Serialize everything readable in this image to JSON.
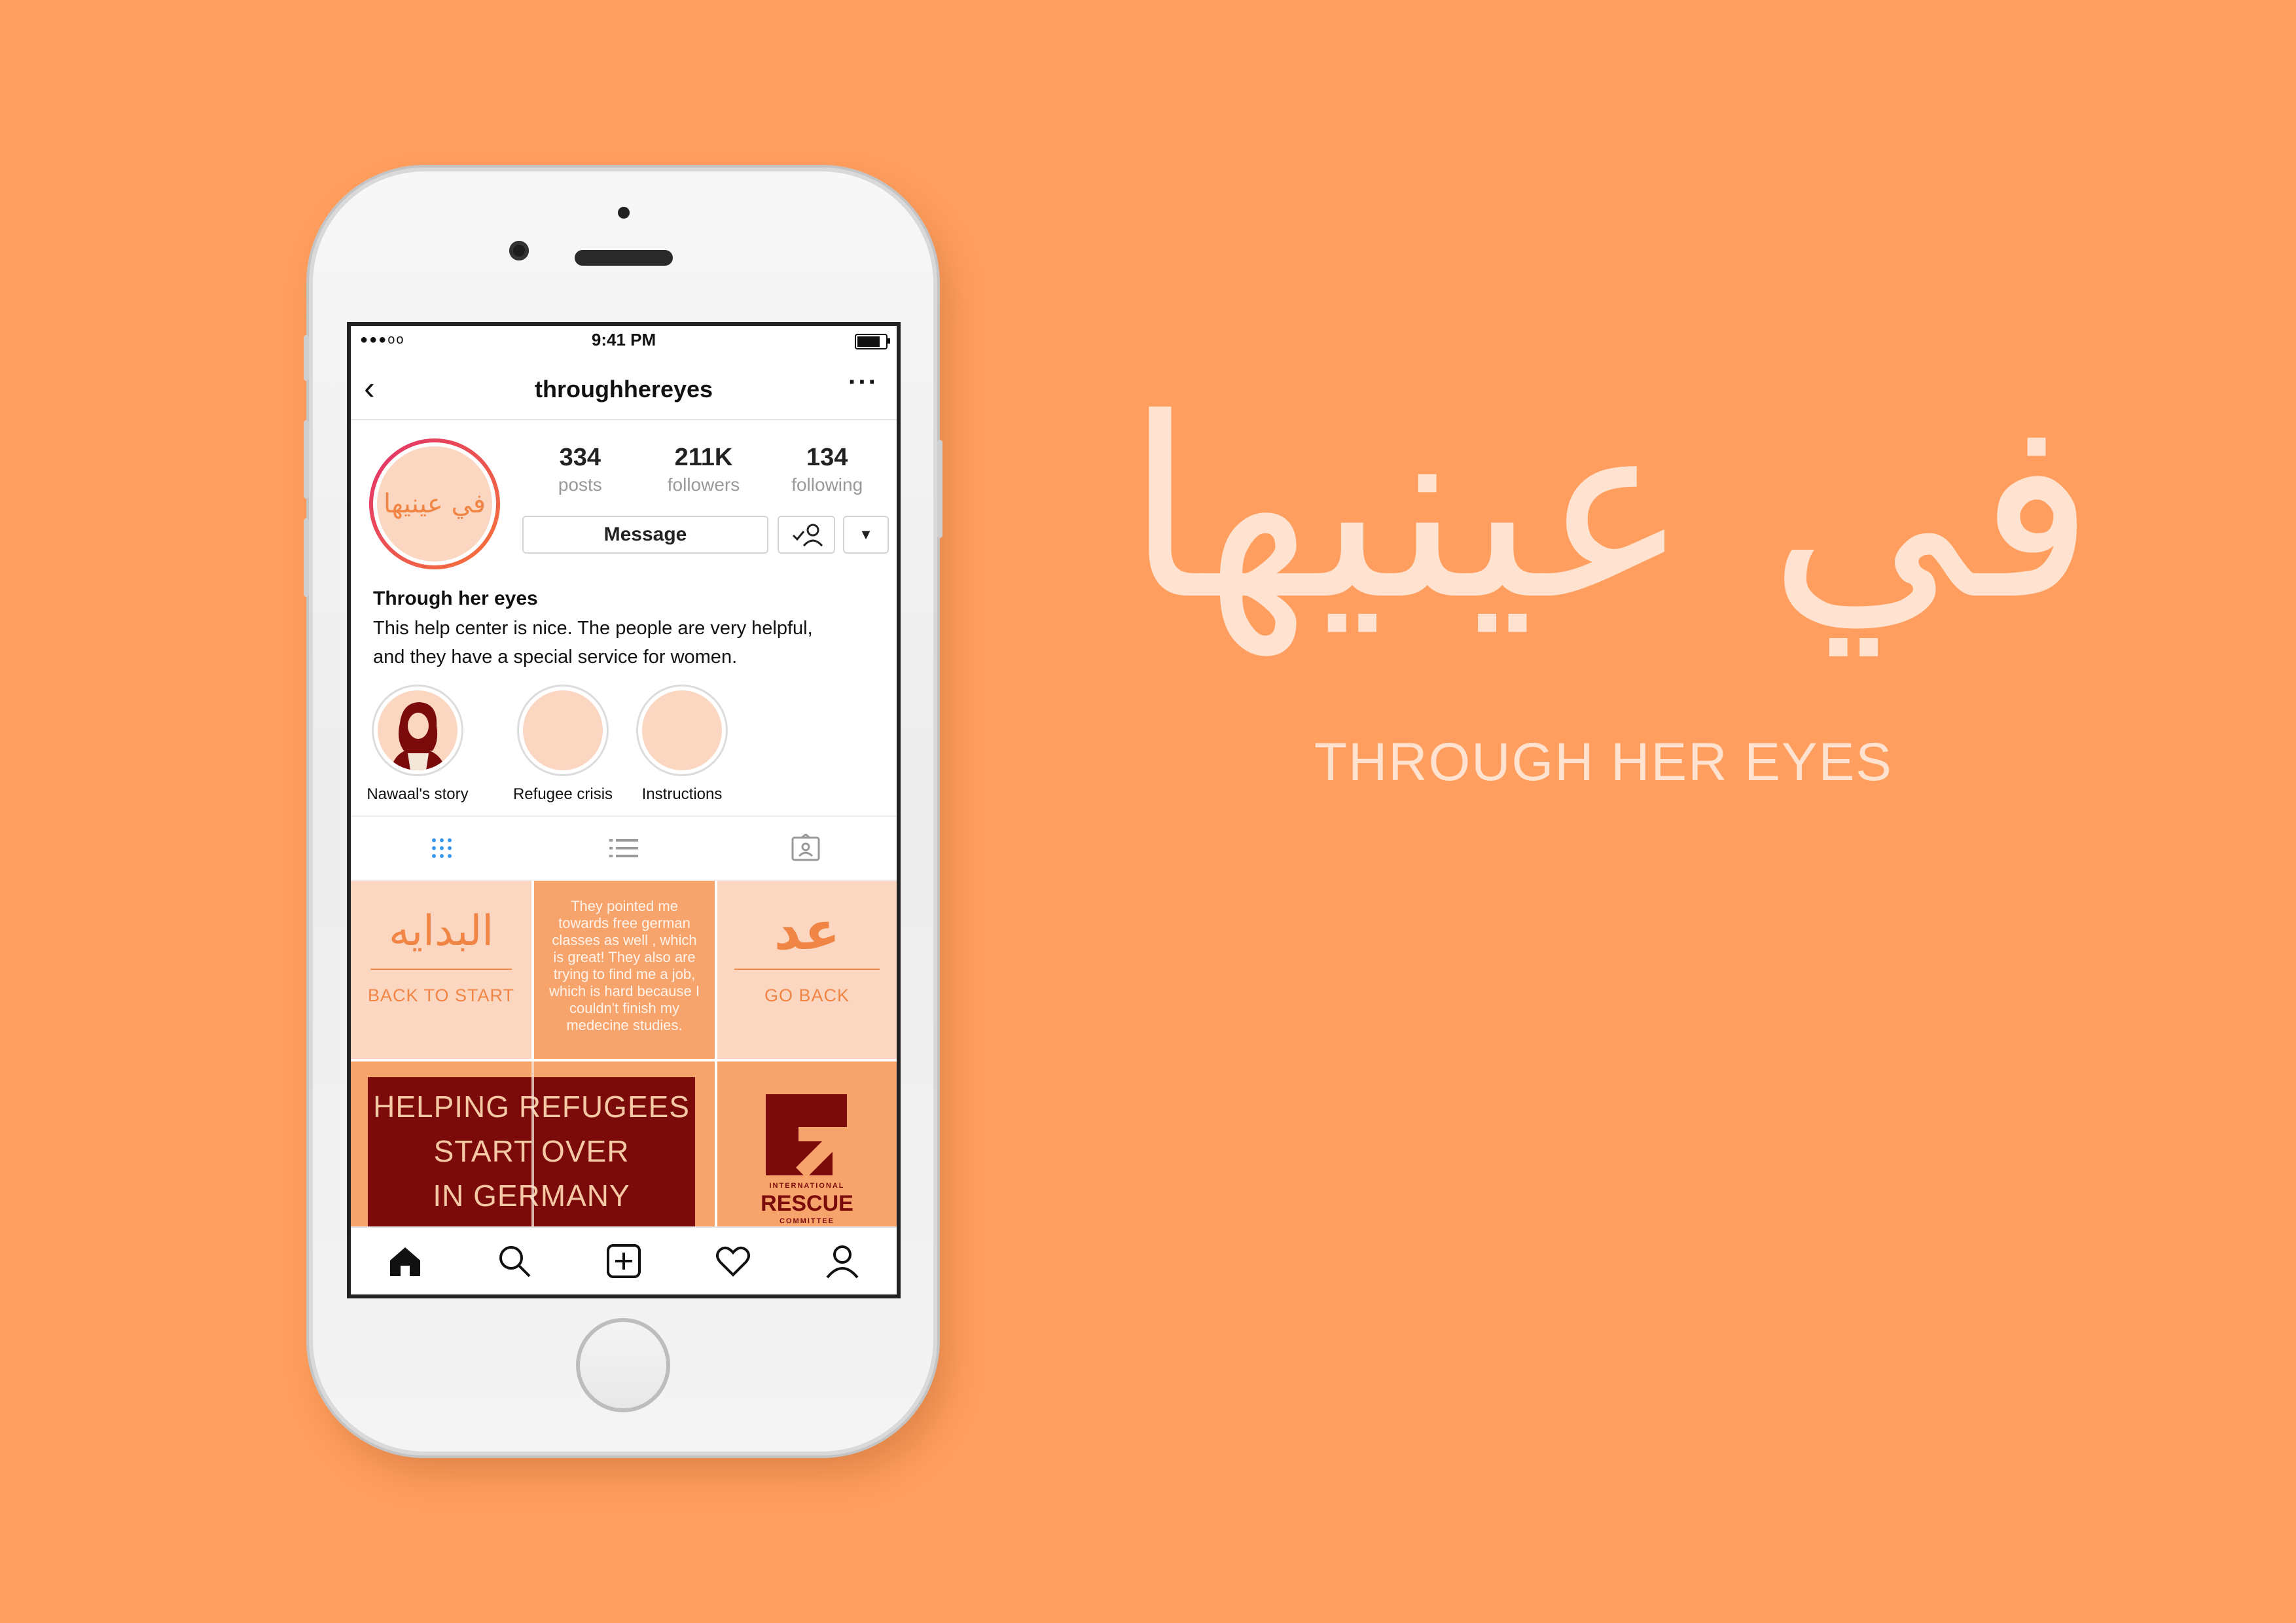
{
  "status_bar": {
    "time": "9:41 PM",
    "signal": "●●●oo"
  },
  "nav": {
    "username": "throughhereyes",
    "back_glyph": "‹",
    "more_glyph": "···"
  },
  "profile": {
    "avatar_text": "في عينيها",
    "stats": [
      {
        "value": "334",
        "label": "posts"
      },
      {
        "value": "211K",
        "label": "followers"
      },
      {
        "value": "134",
        "label": "following"
      }
    ],
    "message_label": "Message",
    "dropdown_glyph": "▼",
    "name": "Through her eyes",
    "bio_line1": "This help center is nice. The people are very helpful,",
    "bio_line2": "and they have a special service for women."
  },
  "highlights": [
    {
      "label": "Nawaal's story"
    },
    {
      "label": "Refugee crisis"
    },
    {
      "label": "Instructions"
    }
  ],
  "grid": {
    "post1": {
      "arabic": "البدايه",
      "caption": "BACK TO START"
    },
    "post2": {
      "quote": "They pointed me towards free german classes as well , which is great! They also are trying to find me a job, which is hard because I couldn't finish my medecine studies."
    },
    "post3": {
      "arabic": "عد",
      "caption": "GO BACK"
    },
    "post4": {
      "line1": "HELPING REFUGEES",
      "line2": "START OVER",
      "line3": "IN GERMANY"
    },
    "post6": {
      "logo_top": "INTERNATIONAL",
      "logo_main": "RESCUE",
      "logo_bottom": "COMMITTEE"
    }
  },
  "hero": {
    "arabic_title": "في عينيها",
    "english_title": "THROUGH HER EYES"
  },
  "colors": {
    "background": "#FF9E5E",
    "accent": "#F08545",
    "peach": "#FBD6C0",
    "maroon": "#7B0B0B",
    "hero_text": "#FFE3D0"
  }
}
